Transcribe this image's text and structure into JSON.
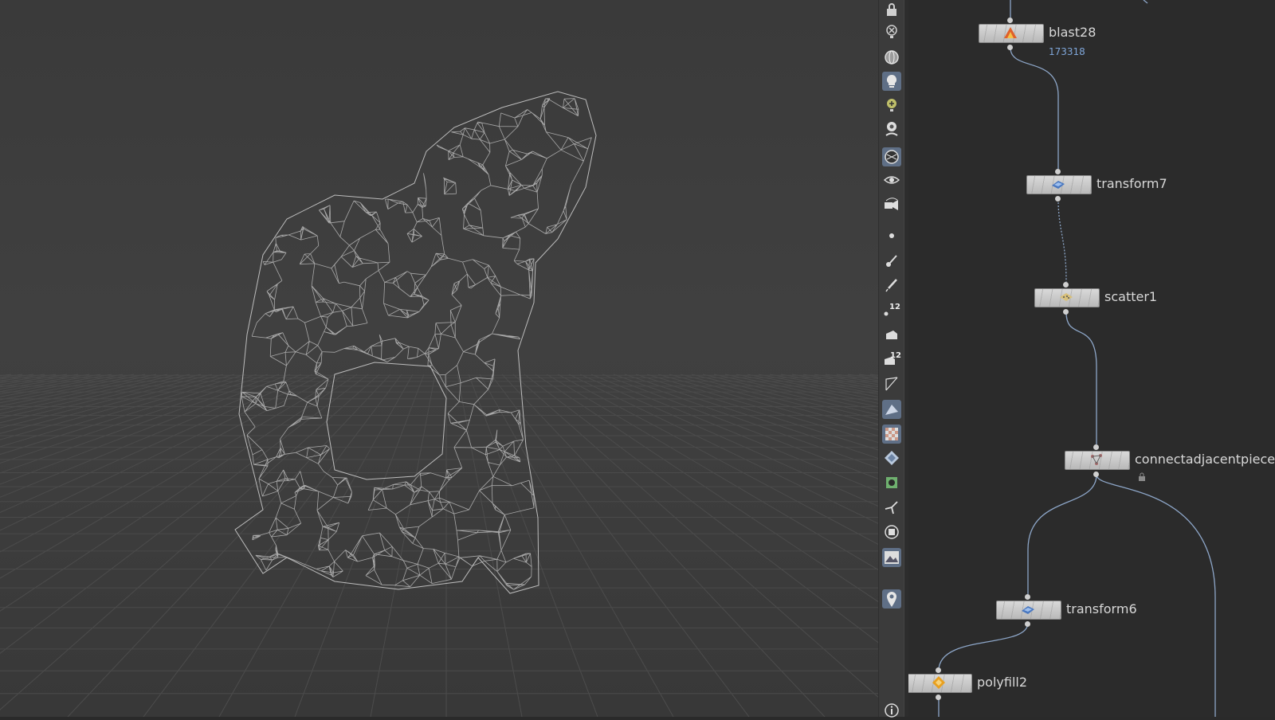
{
  "toolbar": {
    "icons": [
      "lock-icon",
      "light-disabled-icon",
      "sphere-icon",
      "light-bulb-icon",
      "light-add-icon",
      "light-link-icon",
      "camera-sphere-icon",
      "camera-eye-icon",
      "camera-flip-icon",
      "point-icon",
      "brush-icon",
      "pen-icon",
      "point-number-icon",
      "primitive-icon",
      "primitive-number-icon",
      "edge-icon",
      "face-icon",
      "texture-icon",
      "diamond-icon",
      "uv-icon",
      "axis-icon",
      "display-options-icon",
      "background-image-icon",
      "pin-icon",
      "info-icon"
    ],
    "badges": {
      "point_numbers": "12",
      "primitive_numbers": "12"
    }
  },
  "network": {
    "nodes": [
      {
        "id": "blast28",
        "label": "blast28",
        "sub": "173318",
        "icon": "blast-icon"
      },
      {
        "id": "transform7",
        "label": "transform7",
        "icon": "transform-icon"
      },
      {
        "id": "scatter1",
        "label": "scatter1",
        "icon": "scatter-icon"
      },
      {
        "id": "connectadjacentpieces",
        "label": "connectadjacentpieces",
        "icon": "connect-icon"
      },
      {
        "id": "transform6",
        "label": "transform6",
        "icon": "transform-icon"
      },
      {
        "id": "polyfill2",
        "label": "polyfill2",
        "icon": "polyfill-icon"
      }
    ]
  },
  "colors": {
    "viewport_bg": "#3f3f3f",
    "wire": "#8da6c8",
    "node_label": "#d8d8d8",
    "sub_label": "#7fa6d9",
    "active_tool": "#5f6f86"
  }
}
